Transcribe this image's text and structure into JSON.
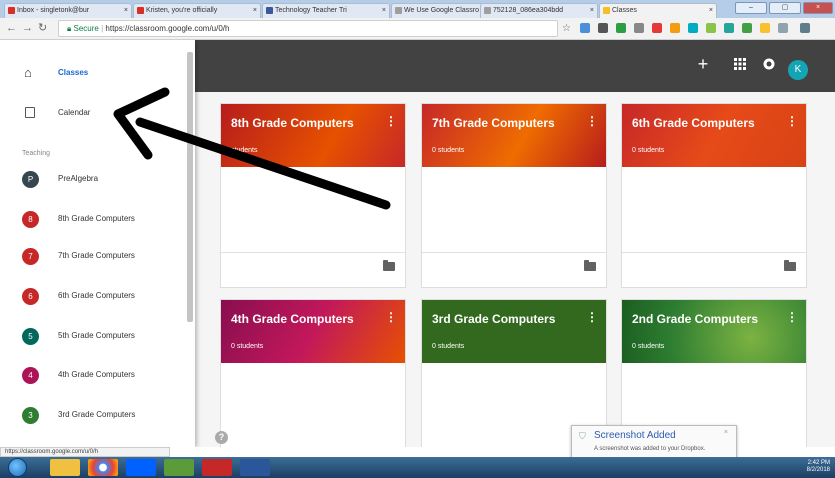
{
  "browser": {
    "tabs": [
      {
        "label": "Inbox - singletonk@bur",
        "color": "#d93025"
      },
      {
        "label": "Kristen, you're officially",
        "color": "#d93025"
      },
      {
        "label": "Technology Teacher Tri",
        "color": "#3b5998"
      },
      {
        "label": "We Use Google Classro",
        "color": "#9e9e9e"
      },
      {
        "label": "752128_086ea304bdd",
        "color": "#9e9e9e"
      },
      {
        "label": "Classes",
        "color": "#f6bf26"
      }
    ],
    "url_secure": "Secure",
    "url": "https://classroom.google.com/u/0/h",
    "status_url": "https://classroom.google.com/u/0/h"
  },
  "topbar": {
    "add_icon": "+",
    "apps_icon": "grid-icon",
    "avatar_letter": "K"
  },
  "sidebar": {
    "classes_label": "Classes",
    "calendar_label": "Calendar",
    "section_label": "Teaching",
    "items": [
      {
        "letter": "P",
        "label": "PreAlgebra",
        "color": "#37474f"
      },
      {
        "letter": "8",
        "label": "8th Grade Computers",
        "color": "#c62828"
      },
      {
        "letter": "7",
        "label": "7th Grade Computers",
        "color": "#c62828"
      },
      {
        "letter": "6",
        "label": "6th Grade Computers",
        "color": "#c62828"
      },
      {
        "letter": "5",
        "label": "5th Grade Computers",
        "color": "#00695c"
      },
      {
        "letter": "4",
        "label": "4th Grade Computers",
        "color": "#ad1457"
      },
      {
        "letter": "3",
        "label": "3rd Grade Computers",
        "color": "#2e7d32"
      }
    ]
  },
  "cards": [
    {
      "title": "8th Grade Computers",
      "students": "students",
      "color": "#c0392b"
    },
    {
      "title": "7th Grade Computers",
      "students": "0 students",
      "color": "#c0392b"
    },
    {
      "title": "6th Grade Computers",
      "students": "0 students",
      "color": "#c0392b"
    },
    {
      "title": "4th Grade Computers",
      "students": "0 students",
      "color": "#ad1457"
    },
    {
      "title": "3rd Grade Computers",
      "students": "0 students",
      "color": "#33691e"
    },
    {
      "title": "2nd Grade Computers",
      "students": "0 students",
      "color": "#2e7d32"
    }
  ],
  "toast": {
    "title": "Screenshot Added",
    "message": "A screenshot was added to your Dropbox."
  },
  "taskbar": {
    "time": "2:42 PM",
    "date": "8/2/2018"
  }
}
